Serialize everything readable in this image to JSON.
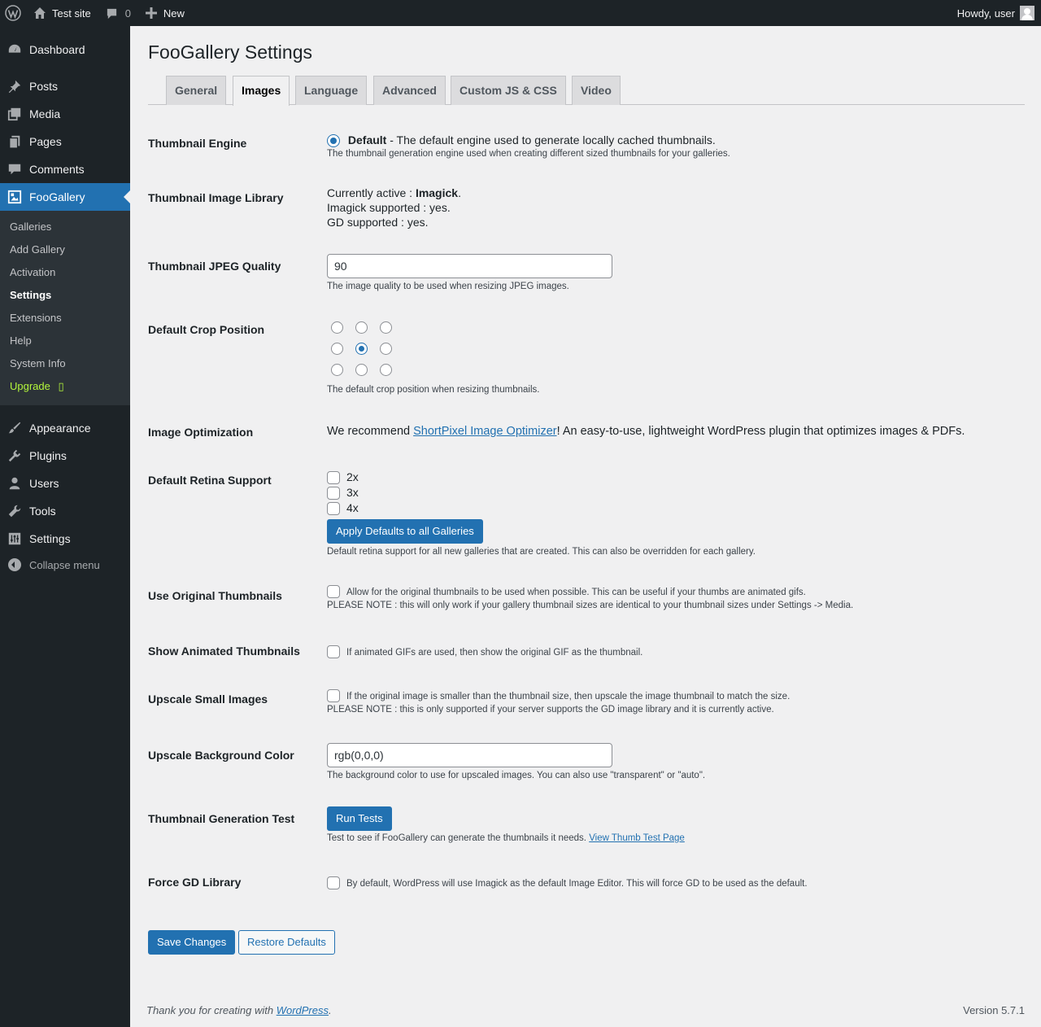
{
  "adminbar": {
    "site_name": "Test site",
    "comments_count": "0",
    "new_label": "New",
    "howdy": "Howdy, user"
  },
  "sidebar": {
    "menu": [
      {
        "label": "Dashboard",
        "icon": "dashboard-icon"
      },
      {
        "label": "Posts",
        "icon": "pin-icon"
      },
      {
        "label": "Media",
        "icon": "media-icon"
      },
      {
        "label": "Pages",
        "icon": "pages-icon"
      },
      {
        "label": "Comments",
        "icon": "comment-icon"
      },
      {
        "label": "FooGallery",
        "icon": "gallery-icon"
      },
      {
        "label": "Appearance",
        "icon": "brush-icon"
      },
      {
        "label": "Plugins",
        "icon": "plugin-icon"
      },
      {
        "label": "Users",
        "icon": "user-icon"
      },
      {
        "label": "Tools",
        "icon": "wrench-icon"
      },
      {
        "label": "Settings",
        "icon": "settings-icon"
      }
    ],
    "submenu": [
      "Galleries",
      "Add Gallery",
      "Activation",
      "Settings",
      "Extensions",
      "Help",
      "System Info",
      "Upgrade"
    ],
    "upgrade_glyph": "▯",
    "collapse_label": "Collapse menu"
  },
  "page": {
    "title": "FooGallery Settings",
    "tabs": [
      "General",
      "Images",
      "Language",
      "Advanced",
      "Custom JS & CSS",
      "Video"
    ]
  },
  "settings": {
    "thumb_engine": {
      "label": "Thumbnail Engine",
      "option_bold": "Default",
      "option_rest": " - The default engine used to generate locally cached thumbnails.",
      "desc": "The thumbnail generation engine used when creating different sized thumbnails for your galleries."
    },
    "thumb_library": {
      "label": "Thumbnail Image Library",
      "active_prefix": "Currently active : ",
      "active_value": "Imagick",
      "active_suffix": ".",
      "imagick": "Imagick supported : yes.",
      "gd": "GD supported : yes."
    },
    "jpeg_quality": {
      "label": "Thumbnail JPEG Quality",
      "value": "90",
      "desc": "The image quality to be used when resizing JPEG images."
    },
    "crop_position": {
      "label": "Default Crop Position",
      "selected": "center",
      "desc": "The default crop position when resizing thumbnails."
    },
    "optimization": {
      "label": "Image Optimization",
      "prefix": "We recommend ",
      "link": "ShortPixel Image Optimizer",
      "suffix": "! An easy-to-use, lightweight WordPress plugin that optimizes images & PDFs."
    },
    "retina": {
      "label": "Default Retina Support",
      "options": [
        "2x",
        "3x",
        "4x"
      ],
      "button": "Apply Defaults to all Galleries",
      "desc": "Default retina support for all new galleries that are created. This can also be overridden for each gallery."
    },
    "original_thumbs": {
      "label": "Use Original Thumbnails",
      "text": "Allow for the original thumbnails to be used when possible. This can be useful if your thumbs are animated gifs.",
      "note": "PLEASE NOTE : this will only work if your gallery thumbnail sizes are identical to your thumbnail sizes under Settings -> Media."
    },
    "animated": {
      "label": "Show Animated Thumbnails",
      "text": "If animated GIFs are used, then show the original GIF as the thumbnail."
    },
    "upscale": {
      "label": "Upscale Small Images",
      "text": "If the original image is smaller than the thumbnail size, then upscale the image thumbnail to match the size.",
      "note": "PLEASE NOTE : this is only supported if your server supports the GD image library and it is currently active."
    },
    "upscale_bg": {
      "label": "Upscale Background Color",
      "value": "rgb(0,0,0)",
      "desc": "The background color to use for upscaled images. You can also use \"transparent\" or \"auto\"."
    },
    "gen_test": {
      "label": "Thumbnail Generation Test",
      "button": "Run Tests",
      "desc": "Test to see if FooGallery can generate the thumbnails it needs. ",
      "link": "View Thumb Test Page"
    },
    "force_gd": {
      "label": "Force GD Library",
      "text": "By default, WordPress will use Imagick as the default Image Editor. This will force GD to be used as the default."
    }
  },
  "actions": {
    "save": "Save Changes",
    "restore": "Restore Defaults"
  },
  "footer": {
    "thanks_prefix": "Thank you for creating with ",
    "thanks_link": "WordPress",
    "thanks_suffix": ".",
    "version": "Version 5.7.1"
  },
  "colors": {
    "accent": "#2271b1",
    "sidebar_bg": "#1d2327",
    "submenu_bg": "#2c3338",
    "upgrade": "#b4f73b",
    "page_bg": "#f0f0f1"
  }
}
